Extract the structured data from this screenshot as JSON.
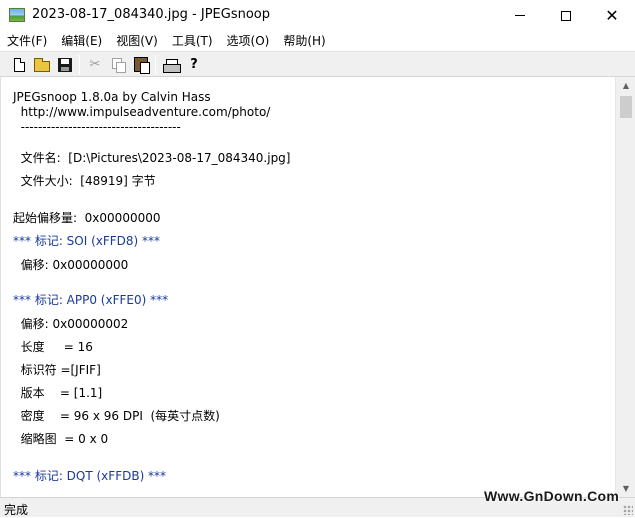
{
  "window": {
    "title": "2023-08-17_084340.jpg - JPEGsnoop",
    "close_symbol": "✕"
  },
  "menu": {
    "items": [
      {
        "label": "文件(F)"
      },
      {
        "label": "编辑(E)"
      },
      {
        "label": "视图(V)"
      },
      {
        "label": "工具(T)"
      },
      {
        "label": "选项(O)"
      },
      {
        "label": "帮助(H)"
      }
    ]
  },
  "toolbar": {
    "icons": [
      "new-file-icon",
      "open-folder-icon",
      "save-icon",
      "cut-icon",
      "copy-icon",
      "paste-icon",
      "print-icon",
      "help-icon"
    ],
    "cut_symbol": "✂",
    "help_symbol": "?"
  },
  "content": {
    "lines": [
      {
        "text": "JPEGsnoop 1.8.0a by Calvin Hass",
        "style": "normal"
      },
      {
        "text": "  http://www.impulseadventure.com/photo/",
        "style": "normal"
      },
      {
        "text": "  -------------------------------------",
        "style": "normal"
      },
      {
        "text": "",
        "style": "normal"
      },
      {
        "text": "  文件名:  [D:\\Pictures\\2023-08-17_084340.jpg]",
        "style": "normal"
      },
      {
        "text": "  文件大小:  [48919] 字节",
        "style": "normal"
      },
      {
        "text": "",
        "style": "normal"
      },
      {
        "text": "起始偏移量:  0x00000000",
        "style": "normal"
      },
      {
        "text": "*** 标记: SOI (xFFD8) ***",
        "style": "blue"
      },
      {
        "text": "  偏移: 0x00000000",
        "style": "normal"
      },
      {
        "text": "",
        "style": "normal"
      },
      {
        "text": "*** 标记: APP0 (xFFE0) ***",
        "style": "blue"
      },
      {
        "text": "  偏移: 0x00000002",
        "style": "normal"
      },
      {
        "text": "  长度     = 16",
        "style": "normal"
      },
      {
        "text": "  标识符 =[JFIF]",
        "style": "normal"
      },
      {
        "text": "  版本    = [1.1]",
        "style": "normal"
      },
      {
        "text": "  密度    = 96 x 96 DPI  (每英寸点数)",
        "style": "normal"
      },
      {
        "text": "  缩略图  = 0 x 0",
        "style": "normal"
      },
      {
        "text": "",
        "style": "normal"
      },
      {
        "text": "*** 标记: DQT (xFFDB) ***",
        "style": "blue"
      }
    ]
  },
  "scrollbar": {
    "up_symbol": "▲",
    "down_symbol": "▼"
  },
  "status": {
    "text": "完成",
    "watermark": "Www.GnDown.Com"
  },
  "colors": {
    "marker_text": "#1a3a9a",
    "toolbar_bg": "#f0f0f0"
  }
}
